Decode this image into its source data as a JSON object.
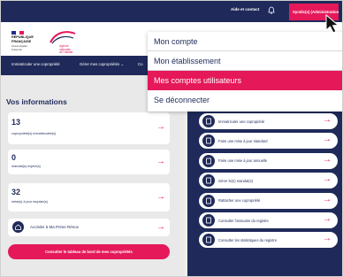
{
  "topbar": {
    "help_label": "Aide et contact",
    "account_label": "Syndic(s) (Administration)"
  },
  "header": {
    "rf_line1": "RÉPUBLIQUE",
    "rf_line2": "FRANÇAISE",
    "rf_motto": "Liberté Égalité Fraternité",
    "anah_line1": "Agence",
    "anah_line2": "nationale",
    "anah_line3": "de l'habitat"
  },
  "nav": {
    "items": [
      {
        "label": "Immatriculer une copropriété"
      },
      {
        "label": "Gérer mes copropriétés ⌄"
      },
      {
        "label": "Co"
      }
    ]
  },
  "dropdown": {
    "items": [
      {
        "label": "Mon compte"
      },
      {
        "label": "Mon établissement"
      },
      {
        "label": "Mes comptes utilisateurs"
      },
      {
        "label": "Se déconnecter"
      }
    ]
  },
  "info": {
    "title": "Vos informations",
    "stats": [
      {
        "value": "13",
        "label": "copropriété(s) immatriculée(s)"
      },
      {
        "value": "0",
        "label": "mandat(s) expiré(s)"
      },
      {
        "value": "32",
        "label": "mise(s) à jour requise(s)"
      }
    ],
    "prime_label": "Accéder à Ma Prime Rénov",
    "dashboard_button": "Consulter le tableau de bord de mes copropriétés"
  },
  "actions": [
    {
      "label": "Immatriculer une copropriété",
      "icon": "building-icon"
    },
    {
      "label": "Faire une mise à jour standard",
      "icon": "update-icon"
    },
    {
      "label": "Faire une mise à jour annuelle",
      "icon": "calendar-icon"
    },
    {
      "label": "Gérer le(s) mandat(s)",
      "icon": "document-icon"
    },
    {
      "label": "Rattacher une copropriété",
      "icon": "link-icon"
    },
    {
      "label": "Consulter l'annuaire du registre",
      "icon": "directory-icon"
    },
    {
      "label": "Consulter les statistiques du registre",
      "icon": "stats-icon"
    }
  ],
  "colors": {
    "navy": "#1f2a5a",
    "accent": "#e5185a"
  }
}
